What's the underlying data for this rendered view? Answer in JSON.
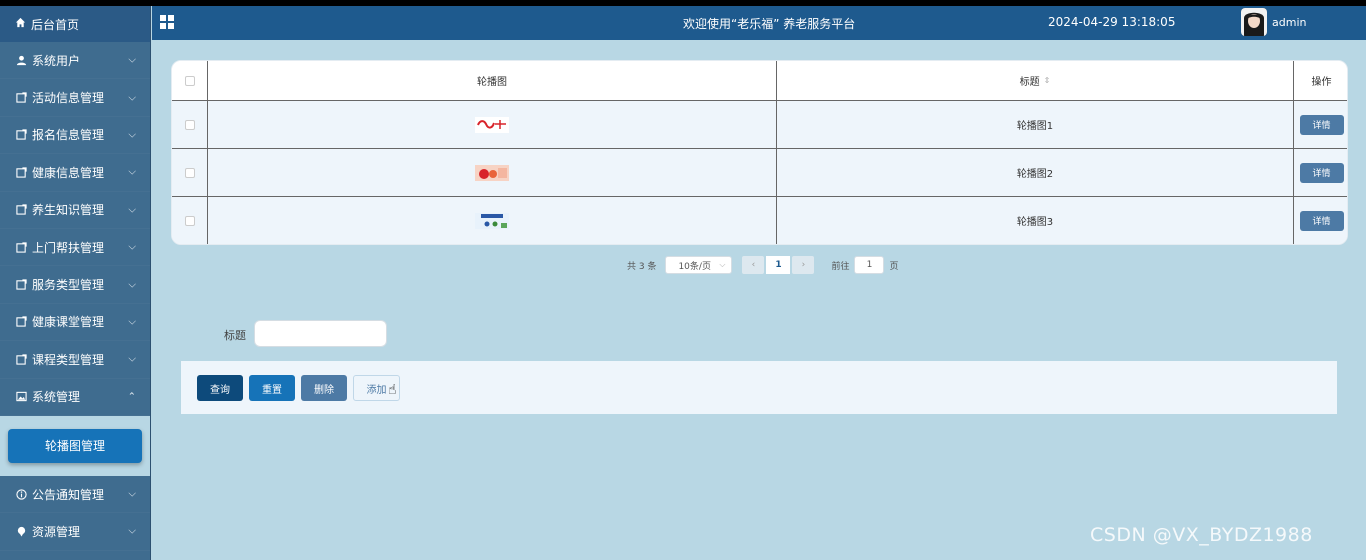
{
  "header": {
    "title": "欢迎使用“老乐福” 养老服务平台",
    "datetime": "2024-04-29 13:18:05",
    "username": "admin"
  },
  "sidebar": {
    "home": "后台首页",
    "items": [
      {
        "label": "系统用户",
        "icon": "user-icon"
      },
      {
        "label": "活动信息管理",
        "icon": "folder-icon"
      },
      {
        "label": "报名信息管理",
        "icon": "folder-icon"
      },
      {
        "label": "健康信息管理",
        "icon": "folder-icon"
      },
      {
        "label": "养生知识管理",
        "icon": "folder-icon"
      },
      {
        "label": "上门帮扶管理",
        "icon": "folder-icon"
      },
      {
        "label": "服务类型管理",
        "icon": "folder-icon"
      },
      {
        "label": "健康课堂管理",
        "icon": "folder-icon"
      },
      {
        "label": "课程类型管理",
        "icon": "folder-icon"
      },
      {
        "label": "系统管理",
        "icon": "image-icon"
      }
    ],
    "active_sub": "轮播图管理",
    "bottom_items": [
      {
        "label": "公告通知管理",
        "icon": "info-icon"
      },
      {
        "label": "资源管理",
        "icon": "pin-icon"
      }
    ]
  },
  "table": {
    "columns": [
      "轮播图",
      "标题",
      "操作"
    ],
    "rows": [
      {
        "title": "轮播图1",
        "action": "详情"
      },
      {
        "title": "轮播图2",
        "action": "详情"
      },
      {
        "title": "轮播图3",
        "action": "详情"
      }
    ]
  },
  "pagination": {
    "total": "共 3 条",
    "page_size": "10条/页",
    "current_page": "1",
    "goto_label": "前往",
    "goto_value": "1",
    "unit": "页"
  },
  "search": {
    "label": "标题",
    "value": ""
  },
  "actions": {
    "query": "查询",
    "reset": "重置",
    "delete": "删除",
    "add": "添加"
  },
  "watermark": "CSDN @VX_BYDZ1988",
  "colors": {
    "header": "#1e5a8e",
    "sidebar": "#3f6c8f",
    "content_bg": "#b8d7e4",
    "primary": "#1673b8"
  }
}
